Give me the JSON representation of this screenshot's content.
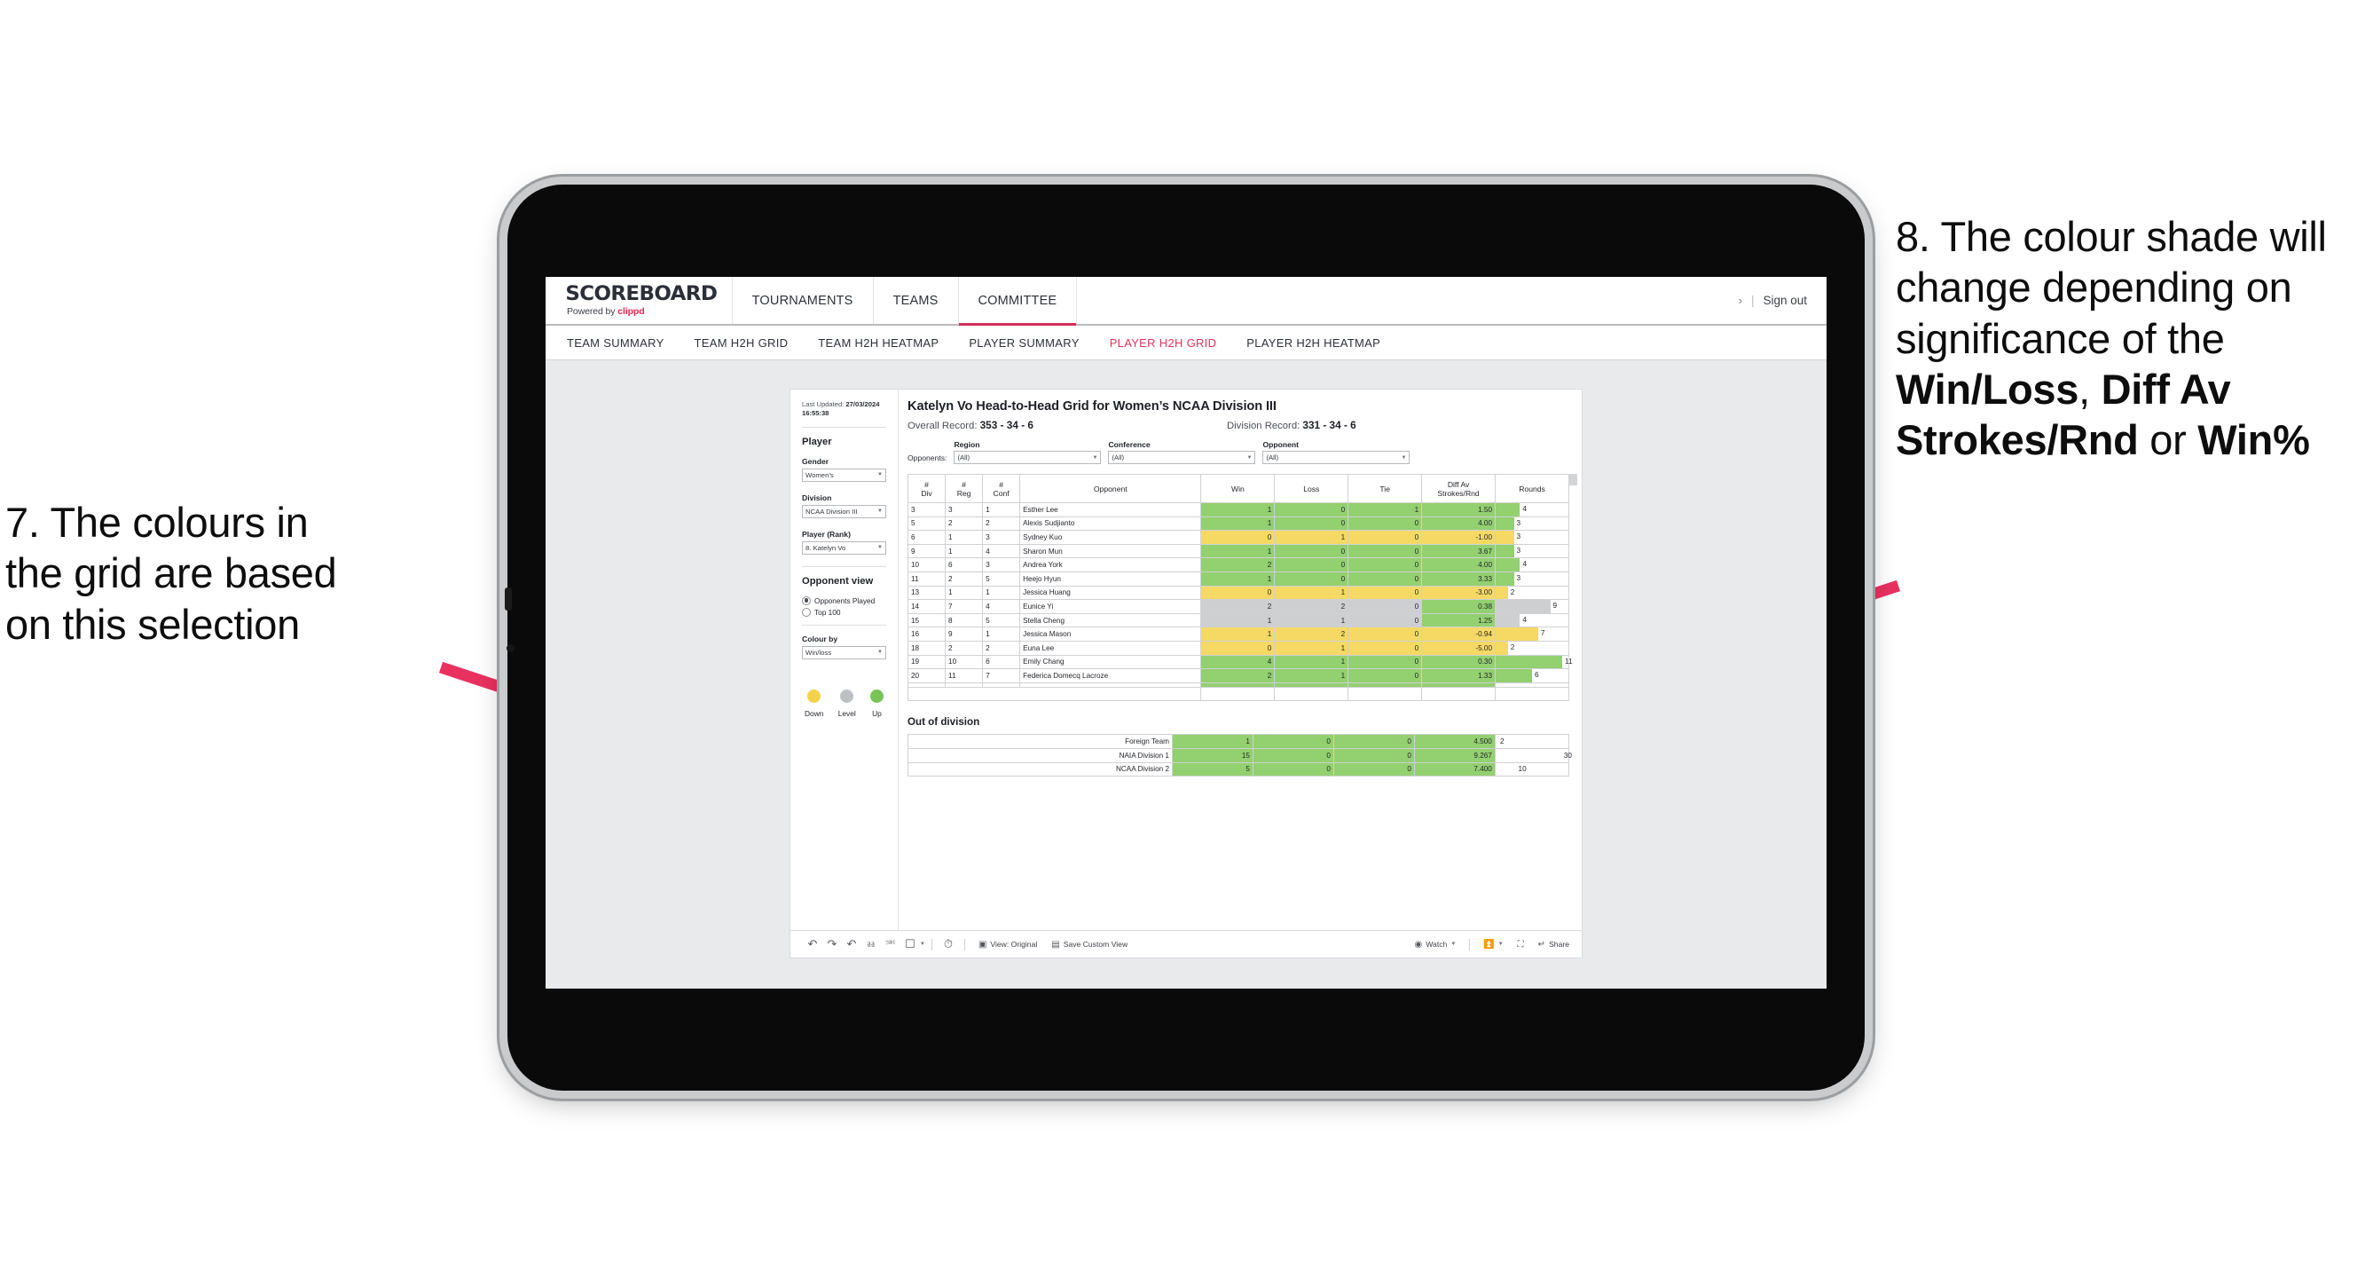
{
  "annotations": {
    "left": {
      "lines": [
        "7. The colours in",
        "the grid are based",
        "on this selection"
      ]
    },
    "right": {
      "pre": "8. The colour shade will change depending on significance of the ",
      "bold1": "Win/Loss",
      "mid1": ", ",
      "bold2": "Diff Av Strokes/Rnd",
      "mid2": " or ",
      "bold3": "Win%"
    },
    "arrow_color": "#e8315f"
  },
  "app": {
    "brand": {
      "name": "SCOREBOARD",
      "powered_prefix": "Powered by ",
      "powered_brand": "clippd"
    },
    "top_tabs": [
      {
        "label": "TOURNAMENTS",
        "active": false
      },
      {
        "label": "TEAMS",
        "active": false
      },
      {
        "label": "COMMITTEE",
        "active": true
      }
    ],
    "top_right": {
      "chevron": "›",
      "divider": "|",
      "signout": "Sign out"
    },
    "sub_nav": [
      {
        "label": "TEAM SUMMARY",
        "active": false
      },
      {
        "label": "TEAM H2H GRID",
        "active": false
      },
      {
        "label": "TEAM H2H HEATMAP",
        "active": false
      },
      {
        "label": "PLAYER SUMMARY",
        "active": false
      },
      {
        "label": "PLAYER H2H GRID",
        "active": true
      },
      {
        "label": "PLAYER H2H HEATMAP",
        "active": false
      }
    ]
  },
  "rail": {
    "last_updated_label": "Last Updated:",
    "last_updated_value": "27/03/2024 16:55:38",
    "player_heading": "Player",
    "gender": {
      "label": "Gender",
      "value": "Women’s"
    },
    "division": {
      "label": "Division",
      "value": "NCAA Division III"
    },
    "player_rank": {
      "label": "Player (Rank)",
      "value": "8. Katelyn Vo"
    },
    "opponent_view": {
      "heading": "Opponent view",
      "options": [
        {
          "label": "Opponents Played",
          "selected": true
        },
        {
          "label": "Top 100",
          "selected": false
        }
      ]
    },
    "colour_by": {
      "label": "Colour by",
      "value": "Win/loss"
    },
    "legend": [
      {
        "label": "Down",
        "color": "#f2d24b"
      },
      {
        "label": "Level",
        "color": "#bdc1c4"
      },
      {
        "label": "Up",
        "color": "#77c456"
      }
    ]
  },
  "main": {
    "title": "Katelyn Vo Head-to-Head Grid for Women’s NCAA Division III",
    "overall_record_label": "Overall Record:",
    "overall_record_value": "353 -  34 - 6",
    "division_record_label": "Division Record:",
    "division_record_value": "331 -  34 - 6",
    "opponents_label": "Opponents:",
    "filters": [
      {
        "label": "Region",
        "value": "(All)"
      },
      {
        "label": "Conference",
        "value": "(All)"
      },
      {
        "label": "Opponent",
        "value": "(All)"
      }
    ],
    "out_of_division_title": "Out of division"
  },
  "chart_data": {
    "type": "table",
    "title": "Katelyn Vo Head-to-Head Grid for Women’s NCAA Division III",
    "columns": [
      "# Div",
      "# Reg",
      "# Conf",
      "Opponent",
      "Win",
      "Loss",
      "Tie",
      "Diff Av Strokes/Rnd",
      "Rounds"
    ],
    "column_headers_two_line": {
      "div": [
        "#",
        "Div"
      ],
      "reg": [
        "#",
        "Reg"
      ],
      "conf": [
        "#",
        "Conf"
      ],
      "opponent": [
        "Opponent"
      ],
      "win": [
        "Win"
      ],
      "loss": [
        "Loss"
      ],
      "tie": [
        "Tie"
      ],
      "diff": [
        "Diff Av",
        "Strokes/Rnd"
      ],
      "rounds": [
        "Rounds"
      ]
    },
    "rounds_max": 12,
    "colors": {
      "up": "#93d070",
      "down": "#f5d964",
      "level": "#cdcfd1"
    },
    "rows": [
      {
        "div": "3",
        "reg": "3",
        "conf": "1",
        "opponent": "Esther Lee",
        "win": "1",
        "loss": "0",
        "tie": "1",
        "diff": "1.50",
        "rounds": "4",
        "rounds_n": 4,
        "shade": "g"
      },
      {
        "div": "5",
        "reg": "2",
        "conf": "2",
        "opponent": "Alexis Sudjianto",
        "win": "1",
        "loss": "0",
        "tie": "0",
        "diff": "4.00",
        "rounds": "3",
        "rounds_n": 3,
        "shade": "g"
      },
      {
        "div": "6",
        "reg": "1",
        "conf": "3",
        "opponent": "Sydney Kuo",
        "win": "0",
        "loss": "1",
        "tie": "0",
        "diff": "-1.00",
        "rounds": "3",
        "rounds_n": 3,
        "shade": "y"
      },
      {
        "div": "9",
        "reg": "1",
        "conf": "4",
        "opponent": "Sharon Mun",
        "win": "1",
        "loss": "0",
        "tie": "0",
        "diff": "3.67",
        "rounds": "3",
        "rounds_n": 3,
        "shade": "g"
      },
      {
        "div": "10",
        "reg": "6",
        "conf": "3",
        "opponent": "Andrea York",
        "win": "2",
        "loss": "0",
        "tie": "0",
        "diff": "4.00",
        "rounds": "4",
        "rounds_n": 4,
        "shade": "g"
      },
      {
        "div": "11",
        "reg": "2",
        "conf": "5",
        "opponent": "Heejo Hyun",
        "win": "1",
        "loss": "0",
        "tie": "0",
        "diff": "3.33",
        "rounds": "3",
        "rounds_n": 3,
        "shade": "g"
      },
      {
        "div": "13",
        "reg": "1",
        "conf": "1",
        "opponent": "Jessica Huang",
        "win": "0",
        "loss": "1",
        "tie": "0",
        "diff": "-3.00",
        "rounds": "2",
        "rounds_n": 2,
        "shade": "y"
      },
      {
        "div": "14",
        "reg": "7",
        "conf": "4",
        "opponent": "Eunice Yi",
        "win": "2",
        "loss": "2",
        "tie": "0",
        "diff": "0.38",
        "rounds": "9",
        "rounds_n": 9,
        "shade": "n",
        "diff_shade": "g"
      },
      {
        "div": "15",
        "reg": "8",
        "conf": "5",
        "opponent": "Stella Cheng",
        "win": "1",
        "loss": "1",
        "tie": "0",
        "diff": "1.25",
        "rounds": "4",
        "rounds_n": 4,
        "shade": "n",
        "diff_shade": "g"
      },
      {
        "div": "16",
        "reg": "9",
        "conf": "1",
        "opponent": "Jessica Mason",
        "win": "1",
        "loss": "2",
        "tie": "0",
        "diff": "-0.94",
        "rounds": "7",
        "rounds_n": 7,
        "shade": "y"
      },
      {
        "div": "18",
        "reg": "2",
        "conf": "2",
        "opponent": "Euna Lee",
        "win": "0",
        "loss": "1",
        "tie": "0",
        "diff": "-5.00",
        "rounds": "2",
        "rounds_n": 2,
        "shade": "y"
      },
      {
        "div": "19",
        "reg": "10",
        "conf": "6",
        "opponent": "Emily Chang",
        "win": "4",
        "loss": "1",
        "tie": "0",
        "diff": "0.30",
        "rounds": "11",
        "rounds_n": 11,
        "shade": "g"
      },
      {
        "div": "20",
        "reg": "11",
        "conf": "7",
        "opponent": "Federica Domecq Lacroze",
        "win": "2",
        "loss": "1",
        "tie": "0",
        "diff": "1.33",
        "rounds": "6",
        "rounds_n": 6,
        "shade": "g"
      }
    ],
    "out_of_division": {
      "rounds_max": 32,
      "rows": [
        {
          "name": "Foreign Team",
          "win": "1",
          "loss": "0",
          "tie": "0",
          "diff": "4.500",
          "rounds": "2",
          "rounds_n": 2,
          "shade": "g"
        },
        {
          "name": "NAIA Division 1",
          "win": "15",
          "loss": "0",
          "tie": "0",
          "diff": "9.267",
          "rounds": "30",
          "rounds_n": 30,
          "shade": "g"
        },
        {
          "name": "NCAA Division 2",
          "win": "5",
          "loss": "0",
          "tie": "0",
          "diff": "7.400",
          "rounds": "10",
          "rounds_n": 10,
          "shade": "g"
        }
      ]
    }
  },
  "toolbar": {
    "icons": [
      "undo-icon",
      "redo-icon",
      "revert-icon",
      "refresh-icon",
      "pause-icon",
      "shape-icon"
    ],
    "view_original": "View: Original",
    "save_custom_view": "Save Custom View",
    "watch": "Watch",
    "share": "Share"
  }
}
